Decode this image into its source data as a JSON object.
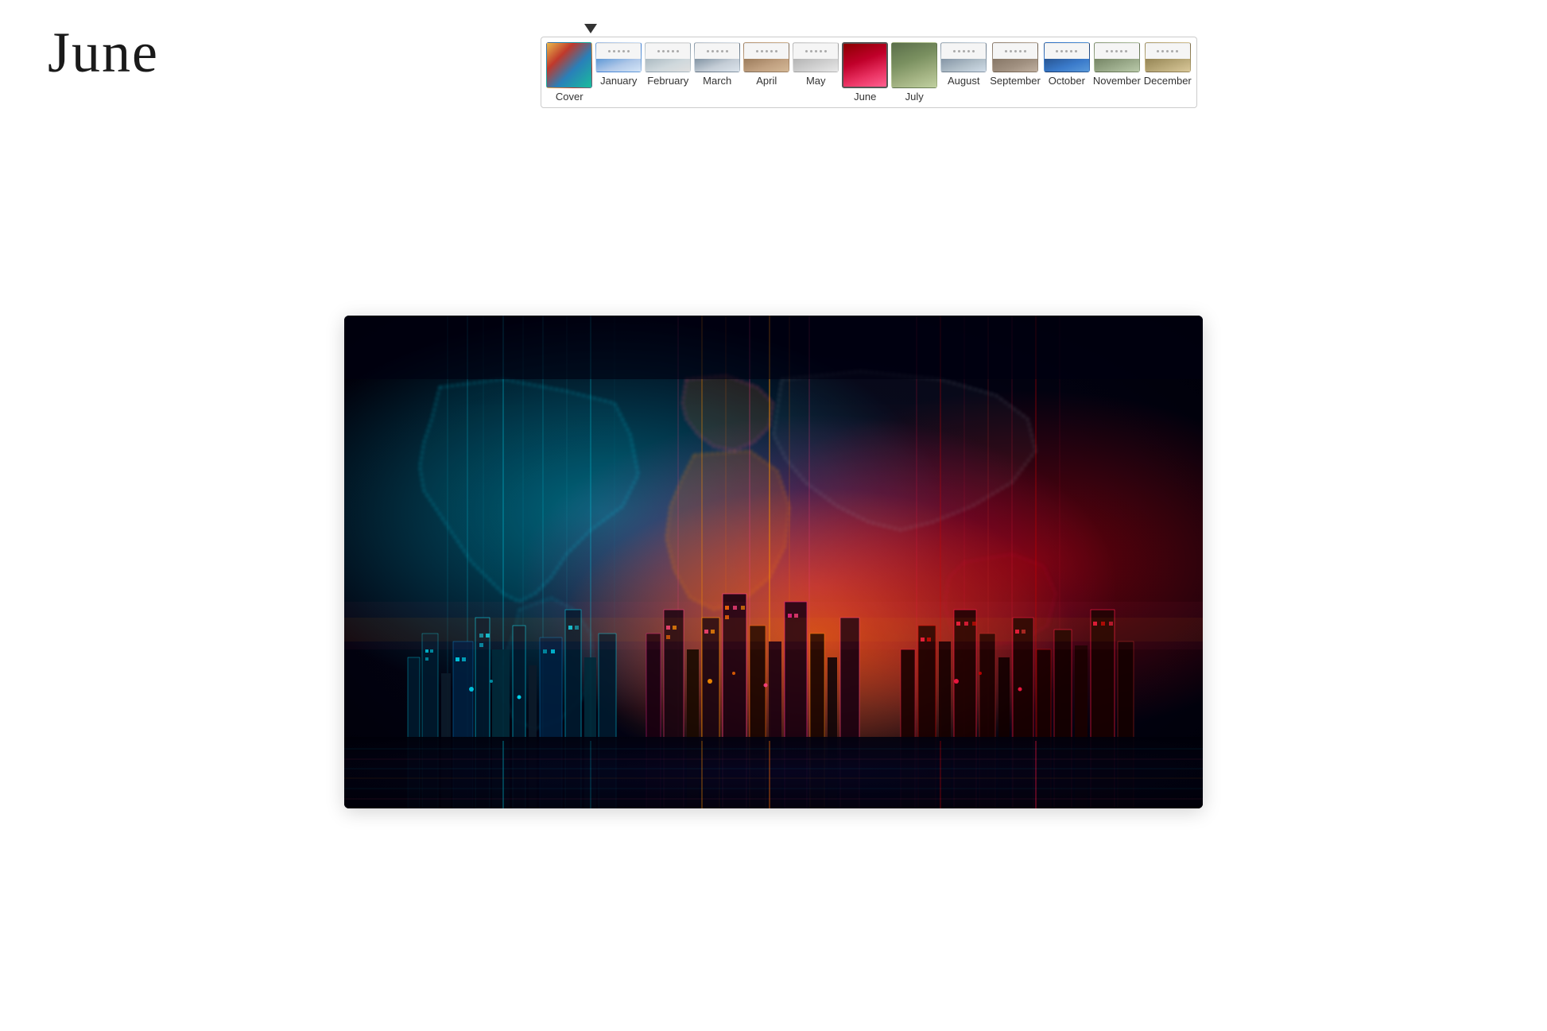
{
  "title": "June",
  "thumbnails": [
    {
      "id": "cover",
      "label": "Cover",
      "class": "thumb-cover",
      "selected": false,
      "hasDots": false
    },
    {
      "id": "january",
      "label": "January",
      "class": "thumb-jan",
      "selected": false,
      "hasDots": true
    },
    {
      "id": "february",
      "label": "February",
      "class": "thumb-feb",
      "selected": false,
      "hasDots": true
    },
    {
      "id": "march",
      "label": "March",
      "class": "thumb-mar",
      "selected": false,
      "hasDots": true
    },
    {
      "id": "april",
      "label": "April",
      "class": "thumb-apr",
      "selected": false,
      "hasDots": true
    },
    {
      "id": "may",
      "label": "May",
      "class": "thumb-may",
      "selected": false,
      "hasDots": true
    },
    {
      "id": "june",
      "label": "June",
      "class": "thumb-jun",
      "selected": true,
      "hasDots": false
    },
    {
      "id": "july",
      "label": "July",
      "class": "thumb-jul",
      "selected": false,
      "hasDots": false
    },
    {
      "id": "august",
      "label": "August",
      "class": "thumb-aug",
      "selected": false,
      "hasDots": true
    },
    {
      "id": "september",
      "label": "September",
      "class": "thumb-sep",
      "selected": false,
      "hasDots": true
    },
    {
      "id": "october",
      "label": "October",
      "class": "thumb-oct",
      "selected": false,
      "hasDots": true
    },
    {
      "id": "november",
      "label": "November",
      "class": "thumb-nov",
      "selected": false,
      "hasDots": true
    },
    {
      "id": "december",
      "label": "December",
      "class": "thumb-dec",
      "selected": false,
      "hasDots": true
    }
  ],
  "main_image_alt": "Neon world map with glowing cyberpunk city skyline"
}
